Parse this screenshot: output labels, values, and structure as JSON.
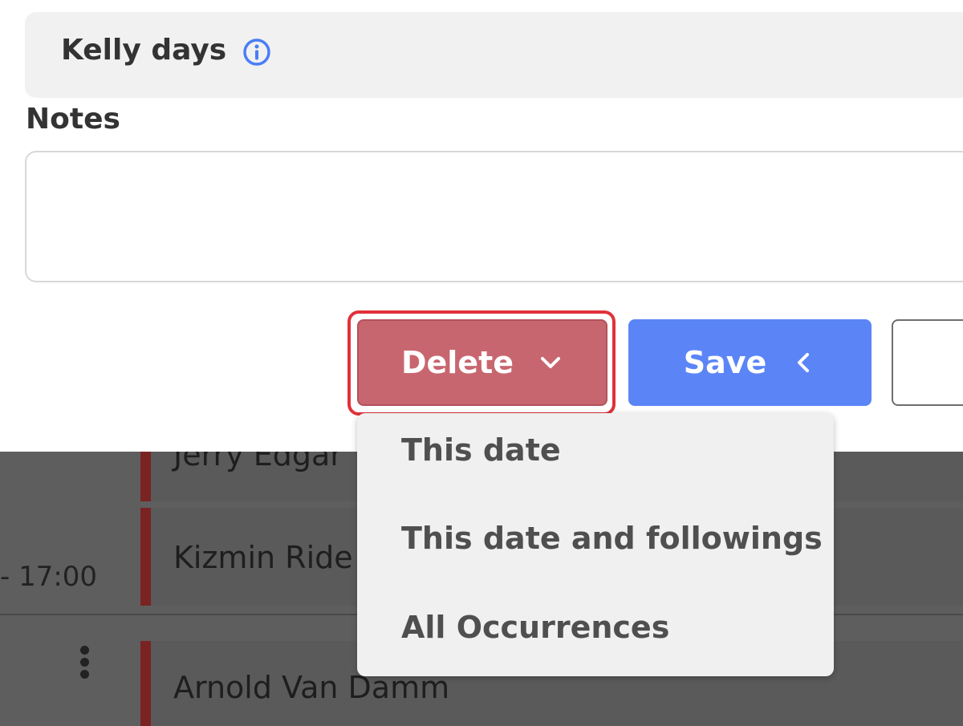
{
  "background": {
    "rows": [
      {
        "name": "Jerry Edgar"
      },
      {
        "name": "Kizmin Ride"
      },
      {
        "name": "Arnold Van Damm"
      }
    ],
    "time_fragment": "- 17:00"
  },
  "modal": {
    "kelly_days_label": "Kelly days",
    "notes_label": "Notes",
    "notes_value": "",
    "delete_label": "Delete",
    "save_label": "Save"
  },
  "delete_menu": {
    "items": [
      "This date",
      "This date and followings",
      "All Occurrences"
    ]
  },
  "colors": {
    "delete": "#c8666f",
    "save": "#5b85f7",
    "focus_ring": "#e0313a",
    "info_icon": "#4a7ef5"
  }
}
